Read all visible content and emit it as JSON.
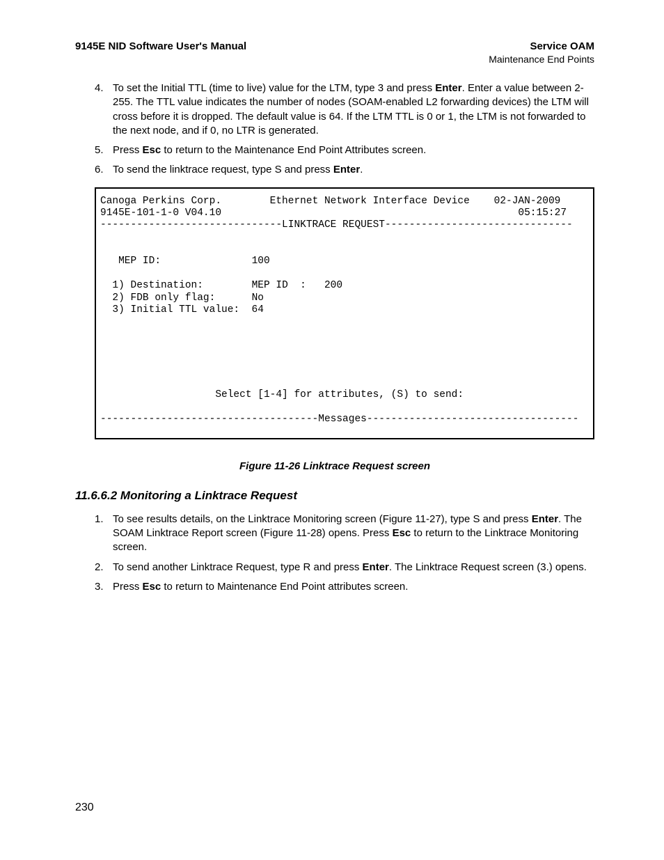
{
  "header": {
    "left": "9145E NID Software User's Manual",
    "right_bold": "Service OAM",
    "right_sub": "Maintenance End Points"
  },
  "steps_a": [
    {
      "num": "4.",
      "pre": "To set the Initial TTL (time to live) value for the LTM, type 3 and press ",
      "b1": "Enter",
      "post": ". Enter a value between 2-255. The TTL value indicates the number of nodes (SOAM-enabled L2 forwarding devices) the LTM will cross before it is dropped. The default value is 64. If the LTM TTL is 0 or 1, the LTM is not forwarded to the next node, and if 0, no LTR is generated."
    },
    {
      "num": "5.",
      "pre": "Press ",
      "b1": "Esc",
      "post": " to return to the Maintenance End Point Attributes screen."
    },
    {
      "num": "6.",
      "pre": "To send the linktrace request, type S and press ",
      "b1": "Enter",
      "post": "."
    }
  ],
  "terminal": {
    "company": "Canoga Perkins Corp.",
    "device": "Ethernet Network Interface Device",
    "date": "02-JAN-2009",
    "model": "9145E-101-1-0 V04.10",
    "time": "05:15:27",
    "title_line": "------------------------------LINKTRACE REQUEST-------------------------------",
    "mep_label": "MEP ID:",
    "mep_value": "100",
    "opt1": "1) Destination:",
    "opt1_val": "MEP ID  :   200",
    "opt2": "2) FDB only flag:",
    "opt2_val": "No",
    "opt3": "3) Initial TTL value:",
    "opt3_val": "64",
    "prompt": "Select [1-4] for attributes, (S) to send:",
    "msg_line": "------------------------------------Messages-----------------------------------"
  },
  "figure_caption": "Figure 11-26  Linktrace Request screen",
  "section_heading": "11.6.6.2 Monitoring a Linktrace Request",
  "steps_b": [
    {
      "num": "1.",
      "pre": "To see results details, on the Linktrace Monitoring screen (Figure 11-27), type S and press ",
      "b1": "Enter",
      "mid": ". The SOAM Linktrace Report screen (Figure 11-28) opens. Press ",
      "b2": "Esc",
      "post": " to return to the Linktrace Monitoring screen."
    },
    {
      "num": "2.",
      "pre": "To send another Linktrace Request, type R and press ",
      "b1": "Enter",
      "mid": "",
      "b2": "",
      "post": ". The Linktrace Request screen (3.) opens."
    },
    {
      "num": "3.",
      "pre": "Press ",
      "b1": "Esc",
      "mid": "",
      "b2": "",
      "post": " to return to Maintenance End Point attributes screen."
    }
  ],
  "page_number": "230"
}
